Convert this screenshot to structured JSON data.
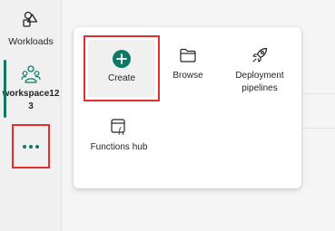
{
  "rail": {
    "workloads": {
      "label": "Workloads",
      "icon": "workloads-icon"
    },
    "workspace": {
      "label": "workspace123",
      "icon": "workspace-people-icon",
      "selected": true
    },
    "more": {
      "icon": "more-dots-icon"
    }
  },
  "flyout": {
    "tiles": [
      {
        "id": "create",
        "label": "Create",
        "icon": "add-circle-icon"
      },
      {
        "id": "browse",
        "label": "Browse",
        "icon": "folder-icon"
      },
      {
        "id": "deployment",
        "label": "Deployment pipelines",
        "icon": "rocket-icon"
      },
      {
        "id": "functions",
        "label": "Functions hub",
        "icon": "functions-hub-icon"
      }
    ]
  },
  "colors": {
    "accent": "#117865",
    "highlight": "#e32e2e",
    "text": "#242424"
  }
}
